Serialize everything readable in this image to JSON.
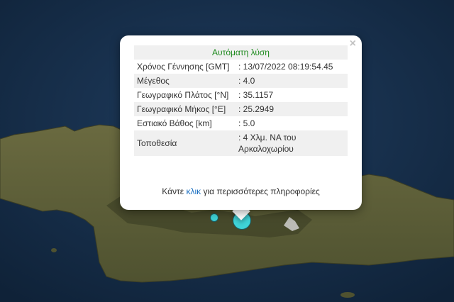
{
  "popup": {
    "title": "Αυτόματη λύση",
    "close_label": "×",
    "rows": [
      {
        "label": "Χρόνος Γέννησης [GMT]",
        "value": ": 13/07/2022 08:19:54.45"
      },
      {
        "label": "Μέγεθος",
        "value": ": 4.0"
      },
      {
        "label": "Γεωγραφικό Πλάτος [°N]",
        "value": ": 35.1157"
      },
      {
        "label": "Γεωγραφικό Μήκος [°E]",
        "value": ": 25.2949"
      },
      {
        "label": "Εστιακό Βάθος [km]",
        "value": ": 5.0"
      },
      {
        "label": "Τοποθεσία",
        "value": ": 4 Χλμ. ΝΑ του Αρκαλοχωρίου"
      }
    ],
    "more_prefix": "Κάντε ",
    "more_link": "κλικ",
    "more_suffix": " για περισσότερες πληροφορίες"
  },
  "colors": {
    "sea": "#162d4a",
    "land": "#5a5a34",
    "marker": "#3fd3d8",
    "title_green": "#1e8a1e",
    "link_blue": "#1a6fc1"
  },
  "markers": [
    {
      "name": "selected-earthquake",
      "size": "large"
    },
    {
      "name": "earthquake",
      "size": "small"
    }
  ]
}
